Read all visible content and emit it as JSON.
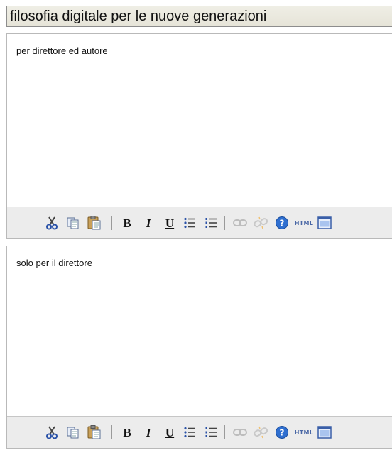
{
  "title_field": {
    "value": "filosofia digitale per le nuove generazioni"
  },
  "editors": [
    {
      "content": "per direttore ed autore"
    },
    {
      "content": "solo per il direttore"
    }
  ],
  "toolbar_buttons": {
    "cut": "scissors-icon",
    "copy": "copy-icon",
    "paste": "paste-icon",
    "bold": "B",
    "italic": "I",
    "underline": "U",
    "bullet_list": "bullet-list-icon",
    "numbered_list": "numbered-list-icon",
    "link": "link-icon",
    "unlink": "unlink-icon",
    "help": "help-icon",
    "html": "HTML",
    "fullscreen": "fullscreen-icon"
  },
  "colors": {
    "title_field_bg": "#e9e8dc",
    "toolbar_bg": "#ececec",
    "help_icon": "#2f6fd0",
    "html_label": "#4a67a5"
  }
}
